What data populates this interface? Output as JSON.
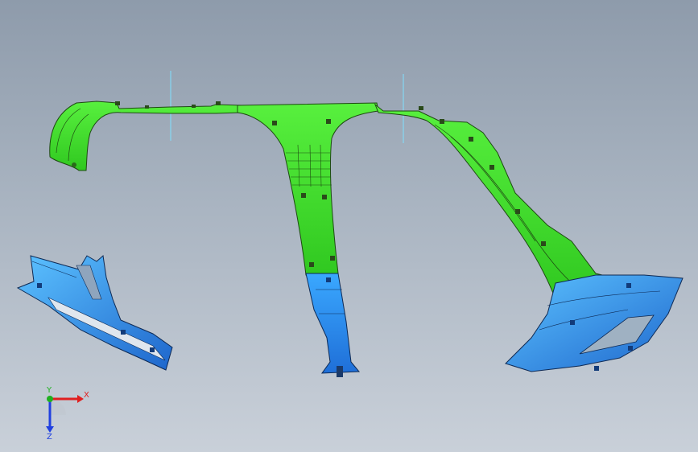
{
  "viewport": {
    "background_top": "#8e9bab",
    "background_bottom": "#c9d0d9"
  },
  "model": {
    "green_color": "#3ee02a",
    "blue_color": "#2a8ff0",
    "edge_color": "#1a3a10"
  },
  "triad": {
    "x_label": "X",
    "y_label": "Y",
    "z_label": "Z",
    "x_color": "#e02020",
    "y_color": "#20b020",
    "z_color": "#2040e0"
  }
}
